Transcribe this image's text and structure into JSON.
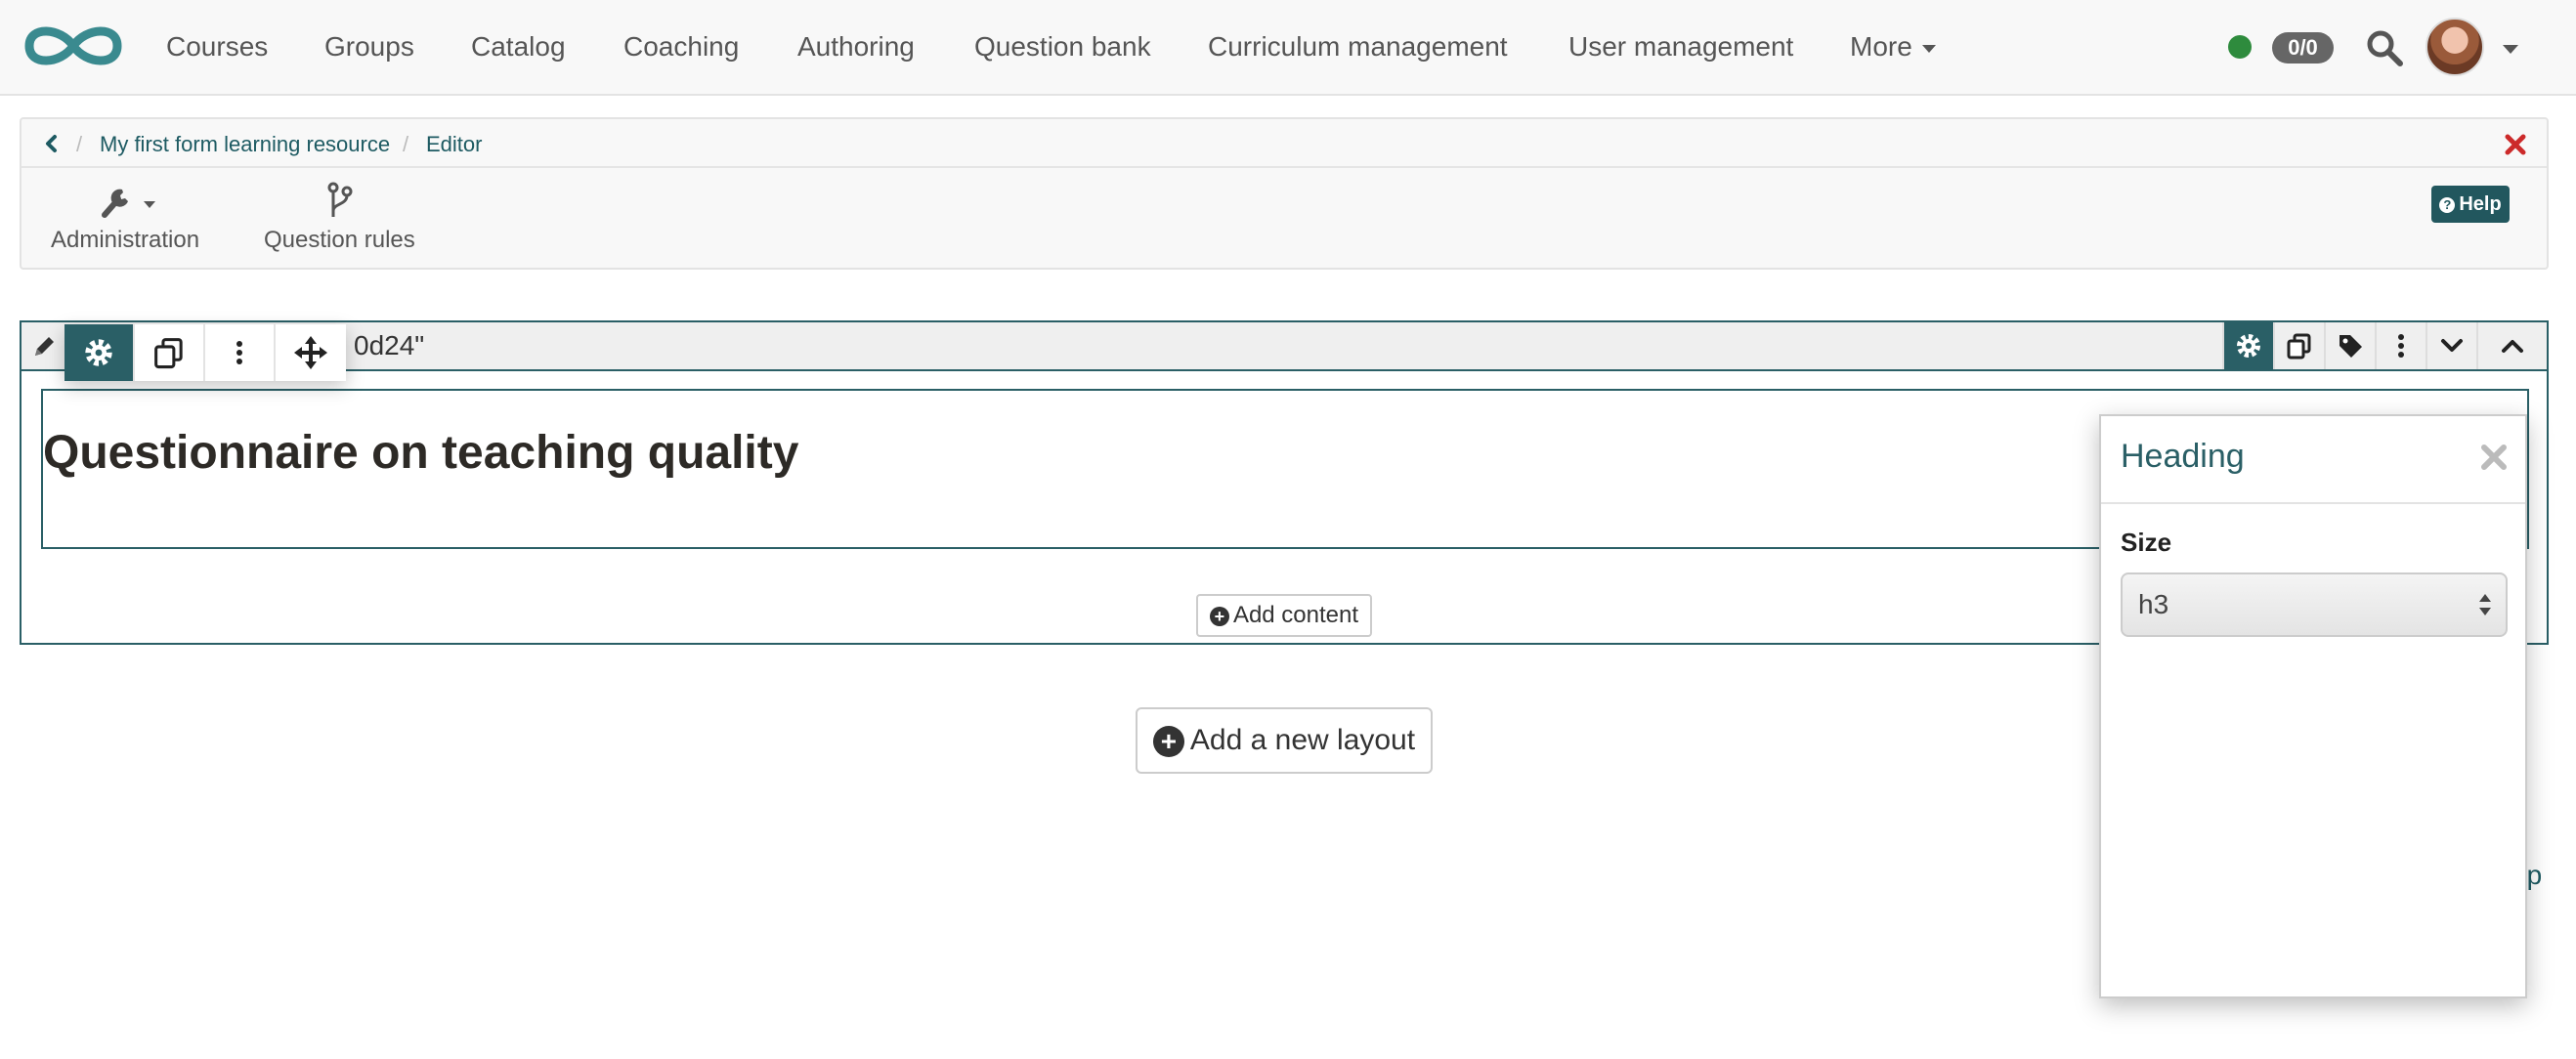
{
  "nav": {
    "items": [
      "Courses",
      "Groups",
      "Catalog",
      "Coaching",
      "Authoring",
      "Question bank",
      "Curriculum management",
      "User management"
    ],
    "more_label": "More",
    "counter": "0/0",
    "status_color": "#2e8b3d"
  },
  "breadcrumb": {
    "items": [
      "My first form learning resource",
      "Editor"
    ]
  },
  "toolbar": {
    "administration_label": "Administration",
    "question_rules_label": "Question rules",
    "help_label": "Help"
  },
  "layout": {
    "title_fragment": "0d24\""
  },
  "heading": {
    "text": "Questionnaire on teaching quality"
  },
  "actions": {
    "add_content": "Add content",
    "add_layout": "Add a new layout",
    "to_top_fragment": "op"
  },
  "inspector": {
    "title": "Heading",
    "size_label": "Size",
    "size_value": "h3"
  },
  "colors": {
    "brand": "#2a5f66",
    "link": "#1d5a62",
    "close_red": "#cc2a2a"
  }
}
